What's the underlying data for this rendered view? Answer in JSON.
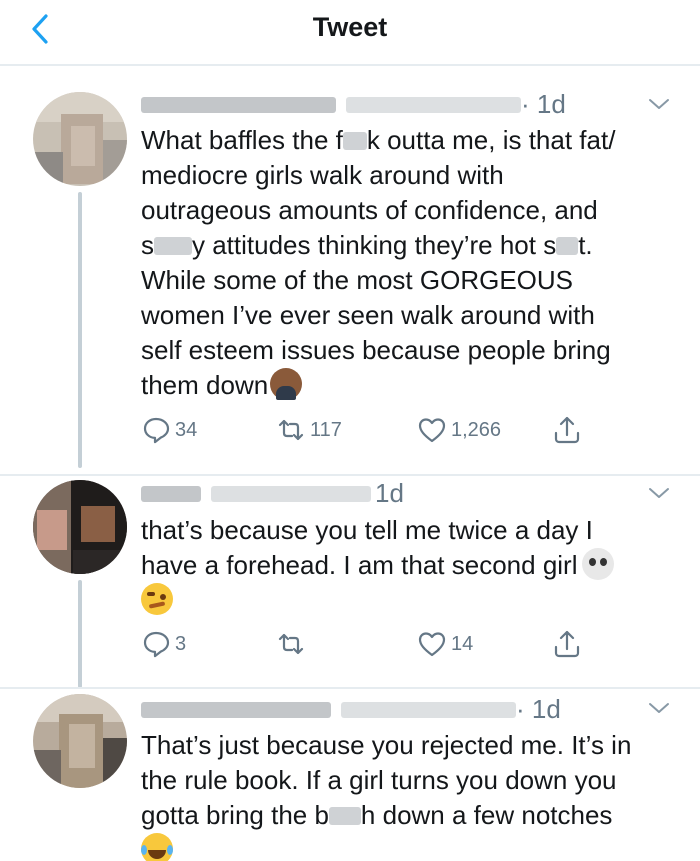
{
  "header": {
    "title": "Tweet",
    "back_icon": "chevron-left-icon",
    "accent": "#1da1f2"
  },
  "tweets": [
    {
      "time": "· 1d",
      "text_parts": [
        "What baffles the f",
        "k outta me, is that fat/\nmediocre girls walk around with\noutrageous amounts of confidence, and\ns",
        "y attitudes thinking they’re hot s",
        "t.\nWhile some of the most GORGEOUS\nwomen I’ve ever seen walk around with\nself esteem issues because people bring\nthem down"
      ],
      "emoji": "man-shrugging-emoji",
      "replies": "34",
      "retweets": "117",
      "likes": "1,266"
    },
    {
      "time": "1d",
      "text_parts": [
        "that’s because you tell me twice a day I\nhave a forehead. I am that second girl"
      ],
      "emoji": "skull-emoji",
      "emoji2": "woozy-face-emoji",
      "replies": "3",
      "retweets": "",
      "likes": "14"
    },
    {
      "time": "· 1d",
      "text_parts": [
        "That’s just because you rejected me. It’s in\nthe rule book. If a girl turns you down you\ngotta bring the b",
        "h down a few notches"
      ],
      "emoji": "tears-of-joy-emoji"
    }
  ],
  "icons": {
    "reply": "reply-icon",
    "retweet": "retweet-icon",
    "like": "heart-icon",
    "share": "share-icon",
    "more": "chevron-down-icon"
  }
}
